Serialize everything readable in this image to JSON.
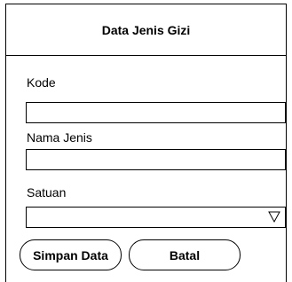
{
  "header": {
    "title": "Data Jenis Gizi"
  },
  "form": {
    "kode": {
      "label": "Kode",
      "value": "",
      "placeholder": ""
    },
    "nama_jenis": {
      "label": "Nama Jenis",
      "value": "",
      "placeholder": ""
    },
    "satuan": {
      "label": "Satuan",
      "selected": "",
      "icon": "dropdown-triangle-icon"
    }
  },
  "buttons": {
    "save": "Simpan Data",
    "cancel": "Batal"
  }
}
